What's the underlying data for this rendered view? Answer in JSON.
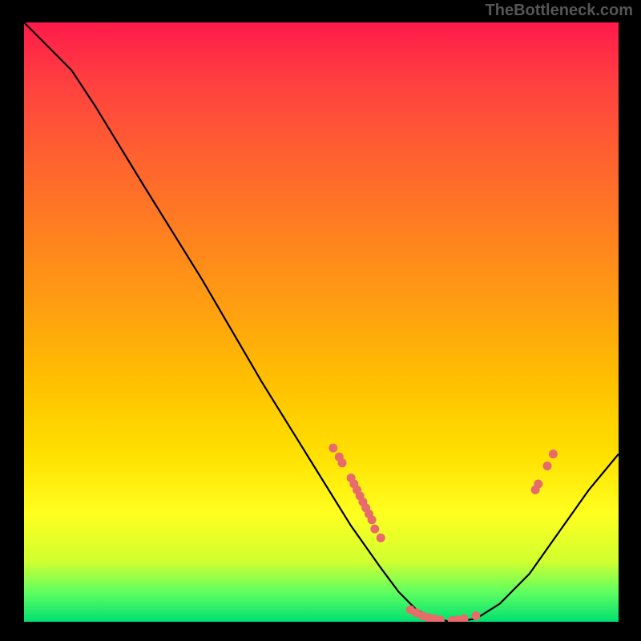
{
  "watermark": "TheBottleneck.com",
  "chart_data": {
    "type": "line",
    "title": "",
    "xlabel": "",
    "ylabel": "",
    "xlim": [
      0,
      100
    ],
    "ylim": [
      0,
      100
    ],
    "curve": [
      {
        "x": 0,
        "y": 100
      },
      {
        "x": 4,
        "y": 96
      },
      {
        "x": 8,
        "y": 92
      },
      {
        "x": 12,
        "y": 86
      },
      {
        "x": 20,
        "y": 73
      },
      {
        "x": 30,
        "y": 57
      },
      {
        "x": 40,
        "y": 40
      },
      {
        "x": 50,
        "y": 24
      },
      {
        "x": 55,
        "y": 16
      },
      {
        "x": 60,
        "y": 9
      },
      {
        "x": 63,
        "y": 5
      },
      {
        "x": 66,
        "y": 2
      },
      {
        "x": 69,
        "y": 0.5
      },
      {
        "x": 72,
        "y": 0
      },
      {
        "x": 76,
        "y": 0.5
      },
      {
        "x": 80,
        "y": 3
      },
      {
        "x": 85,
        "y": 8
      },
      {
        "x": 90,
        "y": 15
      },
      {
        "x": 95,
        "y": 22
      },
      {
        "x": 100,
        "y": 28
      }
    ],
    "scatter": [
      {
        "x": 52,
        "y": 29
      },
      {
        "x": 53,
        "y": 27.5
      },
      {
        "x": 53.5,
        "y": 26.5
      },
      {
        "x": 55,
        "y": 24
      },
      {
        "x": 55.5,
        "y": 23
      },
      {
        "x": 56,
        "y": 22
      },
      {
        "x": 56.5,
        "y": 21
      },
      {
        "x": 57,
        "y": 20
      },
      {
        "x": 57.5,
        "y": 19
      },
      {
        "x": 58,
        "y": 18
      },
      {
        "x": 58.5,
        "y": 17
      },
      {
        "x": 59,
        "y": 15.5
      },
      {
        "x": 60,
        "y": 14
      },
      {
        "x": 65,
        "y": 2
      },
      {
        "x": 66,
        "y": 1.5
      },
      {
        "x": 67,
        "y": 1
      },
      {
        "x": 68,
        "y": 0.7
      },
      {
        "x": 69,
        "y": 0.5
      },
      {
        "x": 70,
        "y": 0.3
      },
      {
        "x": 72,
        "y": 0.2
      },
      {
        "x": 73,
        "y": 0.3
      },
      {
        "x": 74,
        "y": 0.5
      },
      {
        "x": 76,
        "y": 1
      },
      {
        "x": 86,
        "y": 22
      },
      {
        "x": 86.5,
        "y": 23
      },
      {
        "x": 88,
        "y": 26
      },
      {
        "x": 89,
        "y": 28
      }
    ],
    "colors": {
      "line": "#000000",
      "marker": "#e86a6a"
    }
  }
}
